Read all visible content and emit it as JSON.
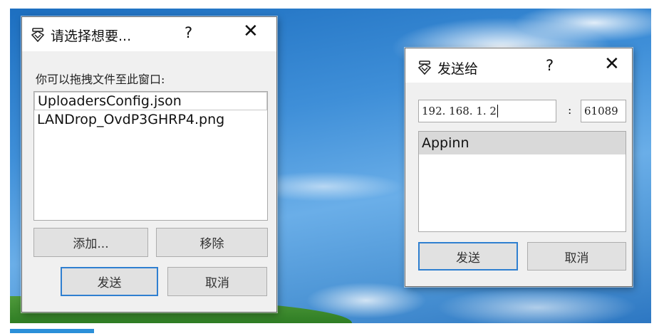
{
  "select_dialog": {
    "title": "请选择想要...",
    "help_label": "?",
    "close_label": "✕",
    "instruction": "你可以拖拽文件至此窗口:",
    "files": [
      "UploadersConfig.json",
      "LANDrop_OvdP3GHRP4.png"
    ],
    "add_label": "添加...",
    "remove_label": "移除",
    "send_label": "发送",
    "cancel_label": "取消"
  },
  "send_dialog": {
    "title": "发送给",
    "help_label": "?",
    "close_label": "✕",
    "ip_value": "192. 168. 1. 2",
    "colon": ":",
    "port_value": "61089",
    "devices": [
      "Appinn"
    ],
    "send_label": "发送",
    "cancel_label": "取消"
  },
  "icons": {
    "app": "landrop-app-icon",
    "close": "close-icon",
    "help": "help-icon"
  },
  "colors": {
    "dialog_bg": "#f0f0f0",
    "default_button_border": "#2f7fd0",
    "selected_item": "#d9d9d9",
    "taskbar_accent": "#2b90d9"
  }
}
